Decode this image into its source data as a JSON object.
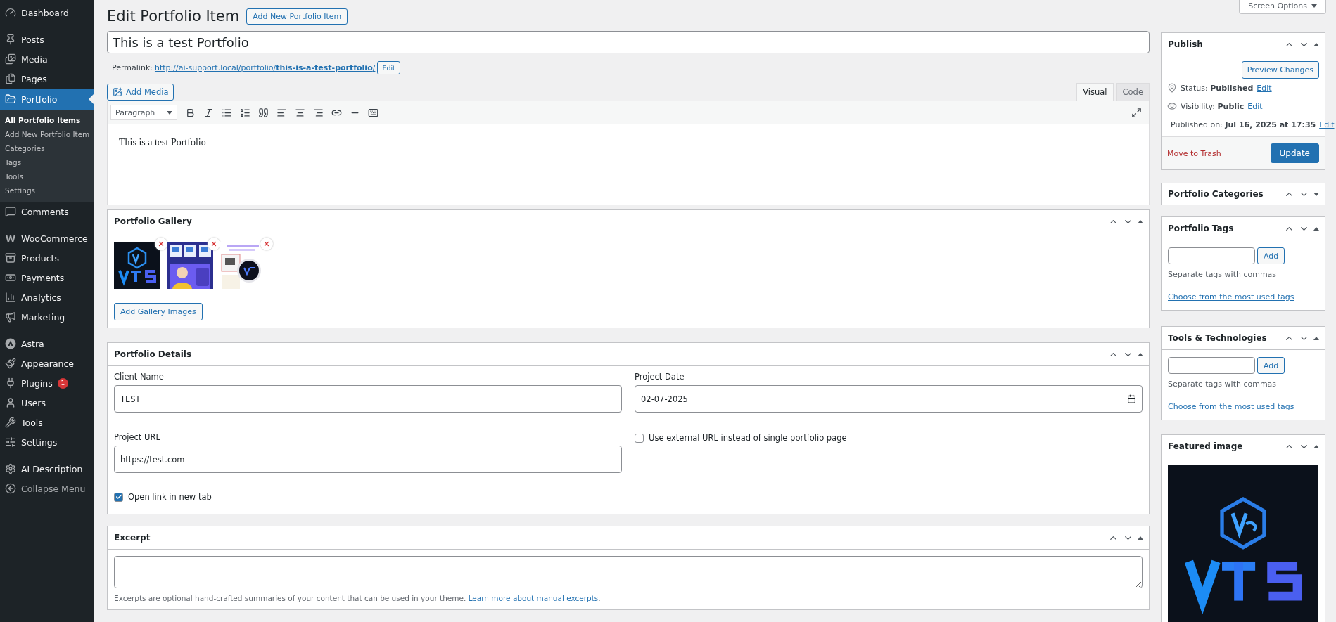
{
  "sidebar": {
    "groups": [
      [
        {
          "label": "Dashboard",
          "kind": "menu",
          "selected": false
        }
      ],
      [
        {
          "label": "Posts",
          "kind": "menu",
          "selected": false
        },
        {
          "label": "Media",
          "kind": "menu",
          "selected": false
        },
        {
          "label": "Pages",
          "kind": "menu",
          "selected": false
        },
        {
          "label": "Portfolio",
          "kind": "menu",
          "selected": true,
          "children": [
            {
              "label": "All Portfolio Items",
              "selected": true
            },
            {
              "label": "Add New Portfolio Item",
              "selected": false
            },
            {
              "label": "Categories",
              "selected": false
            },
            {
              "label": "Tags",
              "selected": false
            },
            {
              "label": "Tools",
              "selected": false
            },
            {
              "label": "Settings",
              "selected": false
            }
          ]
        },
        {
          "label": "Comments",
          "kind": "menu",
          "selected": false
        }
      ],
      [
        {
          "label": "WooCommerce",
          "kind": "menu",
          "selected": false
        },
        {
          "label": "Products",
          "kind": "menu",
          "selected": false
        },
        {
          "label": "Payments",
          "kind": "menu",
          "selected": false
        },
        {
          "label": "Analytics",
          "kind": "menu",
          "selected": false
        },
        {
          "label": "Marketing",
          "kind": "menu",
          "selected": false
        }
      ],
      [
        {
          "label": "Astra",
          "kind": "menu",
          "selected": false
        },
        {
          "label": "Appearance",
          "kind": "menu",
          "selected": false
        },
        {
          "label": "Plugins",
          "kind": "menu",
          "selected": false,
          "badge": "1"
        },
        {
          "label": "Users",
          "kind": "menu",
          "selected": false
        },
        {
          "label": "Tools",
          "kind": "menu",
          "selected": false
        },
        {
          "label": "Settings",
          "kind": "menu",
          "selected": false
        }
      ],
      [
        {
          "label": "AI Description",
          "kind": "menu",
          "selected": false
        },
        {
          "label": "Collapse Menu",
          "kind": "collapse",
          "selected": false
        }
      ]
    ]
  },
  "screen_options": "Screen Options",
  "page_title": "Edit Portfolio Item",
  "add_new_button": "Add New Portfolio Item",
  "post_title": "This is a test Portfolio",
  "permalink": {
    "label": "Permalink:",
    "url": "http://ai-support.local/portfolio/**this-is-a-test-portfolio**/",
    "edit_button": "Edit"
  },
  "editor": {
    "add_media": "Add Media",
    "tabs": [
      {
        "label": "Visual",
        "selected": true
      },
      {
        "label": "Code",
        "selected": false
      }
    ],
    "format": "Paragraph",
    "content": "This is a test Portfolio"
  },
  "gallery": {
    "title": "Portfolio Gallery",
    "expanded": true,
    "button": "Add Gallery Images"
  },
  "details": {
    "title": "Portfolio Details",
    "expanded": true,
    "fields": [
      {
        "label": "Client Name",
        "kind": "text",
        "value": "TEST"
      },
      {
        "label": "Project Date",
        "kind": "date",
        "value": "02-07-2025"
      },
      {
        "label": "Project URL",
        "kind": "text",
        "value": "https://test.com"
      },
      {
        "label": "Use external URL instead of single portfolio page",
        "kind": "checkbox",
        "checked": false
      },
      {
        "label": "Open link in new tab",
        "kind": "checkbox",
        "checked": true
      }
    ]
  },
  "excerpt": {
    "title": "Excerpt",
    "expanded": true,
    "help": "Excerpts are optional hand-crafted summaries of your content that can be used in your theme.",
    "help_link": "Learn more about manual excerpts",
    "help_end": "."
  },
  "publish": {
    "title": "Publish",
    "expanded": true,
    "preview_button": "Preview Changes",
    "rows": [
      {
        "label": "Status:",
        "value": "Published",
        "edit": "Edit"
      },
      {
        "label": "Visibility:",
        "value": "Public",
        "edit": "Edit"
      },
      {
        "label": "Published on:",
        "value": "Jul 16, 2025 at 17:35",
        "edit": "Edit"
      }
    ],
    "trash_link": "Move to Trash",
    "update_button": "Update"
  },
  "categories": {
    "title": "Portfolio Categories",
    "expanded": false
  },
  "tag_boxes": [
    {
      "title": "Portfolio Tags",
      "expanded": true,
      "add_button": "Add",
      "hint": "Separate tags with commas",
      "link": "Choose from the most used tags"
    },
    {
      "title": "Tools & Technologies",
      "expanded": true,
      "add_button": "Add",
      "hint": "Separate tags with commas",
      "link": "Choose from the most used tags"
    }
  ],
  "featured": {
    "title": "Featured image",
    "expanded": true
  }
}
